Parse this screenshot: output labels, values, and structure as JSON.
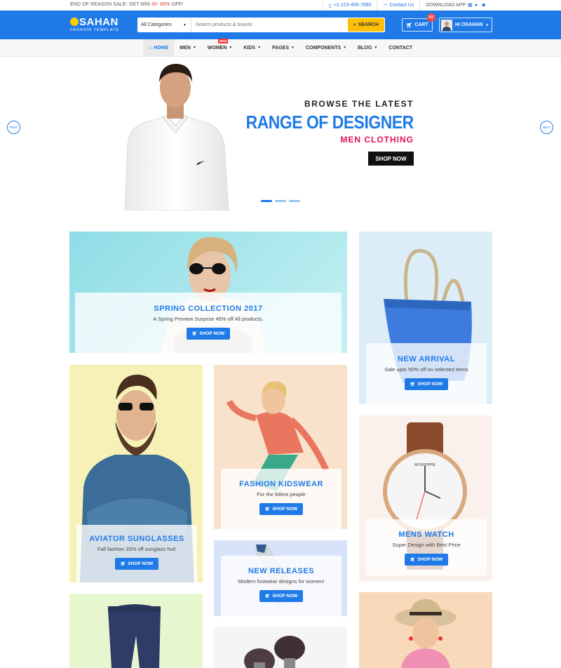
{
  "topbar": {
    "promo_prefix": "END OF REASON SALE- GET MIN",
    "promo_highlight": "40- 80%",
    "promo_suffix": "OFF!",
    "phone": "+1-123-456-7890",
    "contact": "Contact Us",
    "download": "DOWNLOAD APP"
  },
  "header": {
    "logo_name": "SAHAN",
    "logo_sub": "FASHION TEMPLATE",
    "category_label": "All Categories",
    "search_placeholder": "Search products & brands",
    "search_button": "SEARCH",
    "cart_label": "CART",
    "cart_count": "02",
    "user_label": "HI OSAHAN"
  },
  "nav": {
    "items": [
      {
        "label": "HOME"
      },
      {
        "label": "MEN"
      },
      {
        "label": "WOMEN"
      },
      {
        "label": "KIDS"
      },
      {
        "label": "PAGES"
      },
      {
        "label": "COMPONENTS"
      },
      {
        "label": "BLOG"
      },
      {
        "label": "CONTACT"
      }
    ],
    "new_badge": "NEW"
  },
  "hero": {
    "line1": "BROWSE THE LATEST",
    "line2": "RANGE OF DESIGNER",
    "line3": "MEN CLOTHING",
    "button": "SHOP NOW",
    "prev": "PREV",
    "next": "NEXT"
  },
  "cards": {
    "spring": {
      "title": "SPRING COLLECTION 2017",
      "subtitle": "A Spring Preview Surprise 45% off All products.",
      "button": "SHOP NOW"
    },
    "arrival": {
      "title": "NEW ARRIVAL",
      "subtitle": "Sale upto 50% off on selected items",
      "button": "SHOP NOW"
    },
    "aviator": {
      "title": "AVIATOR SUNGLASSES",
      "subtitle": "Fall fashion 35% off sunglass hut!",
      "button": "SHOP NOW"
    },
    "kids": {
      "title": "FASHION KIDSWEAR",
      "subtitle": "For the littlest people",
      "button": "SHOP NOW"
    },
    "releases": {
      "title": "NEW RELEASES",
      "subtitle": "Modern footwear designs for women!",
      "button": "SHOP NOW"
    },
    "watch": {
      "title": "MENS WATCH",
      "subtitle": "Super Design with Best Price",
      "button": "SHOP NOW",
      "brand": "MYSHOPPIE"
    }
  },
  "colors": {
    "primary": "#1f7ae8",
    "accent": "#ffc107",
    "magenta": "#e0115f"
  }
}
